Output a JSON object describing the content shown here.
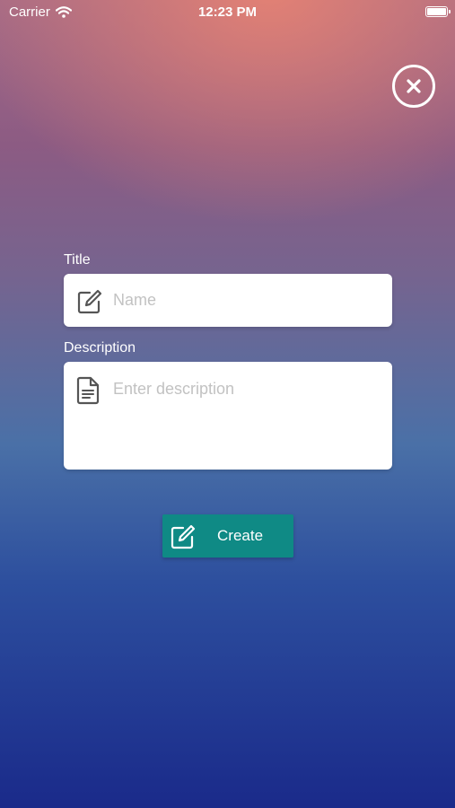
{
  "status_bar": {
    "carrier": "Carrier",
    "time": "12:23 PM"
  },
  "close": {
    "icon": "close-circle-icon"
  },
  "form": {
    "title": {
      "label": "Title",
      "placeholder": "Name",
      "value": "",
      "icon": "edit-icon"
    },
    "description": {
      "label": "Description",
      "placeholder": "Enter description",
      "value": "",
      "icon": "document-icon"
    }
  },
  "create_button": {
    "label": "Create",
    "icon": "edit-icon",
    "color": "#0f8a85"
  }
}
